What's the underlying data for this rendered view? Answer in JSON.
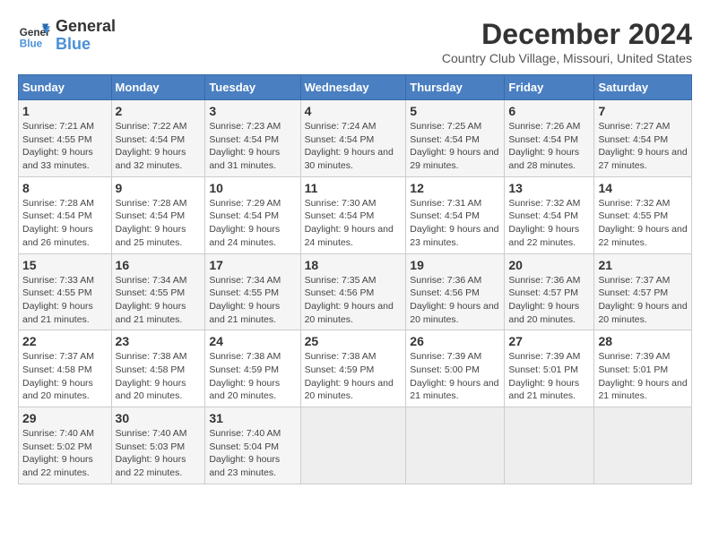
{
  "logo": {
    "line1": "General",
    "line2": "Blue"
  },
  "title": "December 2024",
  "subtitle": "Country Club Village, Missouri, United States",
  "days_header": [
    "Sunday",
    "Monday",
    "Tuesday",
    "Wednesday",
    "Thursday",
    "Friday",
    "Saturday"
  ],
  "weeks": [
    [
      {
        "day": "1",
        "sunrise": "7:21 AM",
        "sunset": "4:55 PM",
        "daylight": "9 hours and 33 minutes."
      },
      {
        "day": "2",
        "sunrise": "7:22 AM",
        "sunset": "4:54 PM",
        "daylight": "9 hours and 32 minutes."
      },
      {
        "day": "3",
        "sunrise": "7:23 AM",
        "sunset": "4:54 PM",
        "daylight": "9 hours and 31 minutes."
      },
      {
        "day": "4",
        "sunrise": "7:24 AM",
        "sunset": "4:54 PM",
        "daylight": "9 hours and 30 minutes."
      },
      {
        "day": "5",
        "sunrise": "7:25 AM",
        "sunset": "4:54 PM",
        "daylight": "9 hours and 29 minutes."
      },
      {
        "day": "6",
        "sunrise": "7:26 AM",
        "sunset": "4:54 PM",
        "daylight": "9 hours and 28 minutes."
      },
      {
        "day": "7",
        "sunrise": "7:27 AM",
        "sunset": "4:54 PM",
        "daylight": "9 hours and 27 minutes."
      }
    ],
    [
      {
        "day": "8",
        "sunrise": "7:28 AM",
        "sunset": "4:54 PM",
        "daylight": "9 hours and 26 minutes."
      },
      {
        "day": "9",
        "sunrise": "7:28 AM",
        "sunset": "4:54 PM",
        "daylight": "9 hours and 25 minutes."
      },
      {
        "day": "10",
        "sunrise": "7:29 AM",
        "sunset": "4:54 PM",
        "daylight": "9 hours and 24 minutes."
      },
      {
        "day": "11",
        "sunrise": "7:30 AM",
        "sunset": "4:54 PM",
        "daylight": "9 hours and 24 minutes."
      },
      {
        "day": "12",
        "sunrise": "7:31 AM",
        "sunset": "4:54 PM",
        "daylight": "9 hours and 23 minutes."
      },
      {
        "day": "13",
        "sunrise": "7:32 AM",
        "sunset": "4:54 PM",
        "daylight": "9 hours and 22 minutes."
      },
      {
        "day": "14",
        "sunrise": "7:32 AM",
        "sunset": "4:55 PM",
        "daylight": "9 hours and 22 minutes."
      }
    ],
    [
      {
        "day": "15",
        "sunrise": "7:33 AM",
        "sunset": "4:55 PM",
        "daylight": "9 hours and 21 minutes."
      },
      {
        "day": "16",
        "sunrise": "7:34 AM",
        "sunset": "4:55 PM",
        "daylight": "9 hours and 21 minutes."
      },
      {
        "day": "17",
        "sunrise": "7:34 AM",
        "sunset": "4:55 PM",
        "daylight": "9 hours and 21 minutes."
      },
      {
        "day": "18",
        "sunrise": "7:35 AM",
        "sunset": "4:56 PM",
        "daylight": "9 hours and 20 minutes."
      },
      {
        "day": "19",
        "sunrise": "7:36 AM",
        "sunset": "4:56 PM",
        "daylight": "9 hours and 20 minutes."
      },
      {
        "day": "20",
        "sunrise": "7:36 AM",
        "sunset": "4:57 PM",
        "daylight": "9 hours and 20 minutes."
      },
      {
        "day": "21",
        "sunrise": "7:37 AM",
        "sunset": "4:57 PM",
        "daylight": "9 hours and 20 minutes."
      }
    ],
    [
      {
        "day": "22",
        "sunrise": "7:37 AM",
        "sunset": "4:58 PM",
        "daylight": "9 hours and 20 minutes."
      },
      {
        "day": "23",
        "sunrise": "7:38 AM",
        "sunset": "4:58 PM",
        "daylight": "9 hours and 20 minutes."
      },
      {
        "day": "24",
        "sunrise": "7:38 AM",
        "sunset": "4:59 PM",
        "daylight": "9 hours and 20 minutes."
      },
      {
        "day": "25",
        "sunrise": "7:38 AM",
        "sunset": "4:59 PM",
        "daylight": "9 hours and 20 minutes."
      },
      {
        "day": "26",
        "sunrise": "7:39 AM",
        "sunset": "5:00 PM",
        "daylight": "9 hours and 21 minutes."
      },
      {
        "day": "27",
        "sunrise": "7:39 AM",
        "sunset": "5:01 PM",
        "daylight": "9 hours and 21 minutes."
      },
      {
        "day": "28",
        "sunrise": "7:39 AM",
        "sunset": "5:01 PM",
        "daylight": "9 hours and 21 minutes."
      }
    ],
    [
      {
        "day": "29",
        "sunrise": "7:40 AM",
        "sunset": "5:02 PM",
        "daylight": "9 hours and 22 minutes."
      },
      {
        "day": "30",
        "sunrise": "7:40 AM",
        "sunset": "5:03 PM",
        "daylight": "9 hours and 22 minutes."
      },
      {
        "day": "31",
        "sunrise": "7:40 AM",
        "sunset": "5:04 PM",
        "daylight": "9 hours and 23 minutes."
      },
      null,
      null,
      null,
      null
    ]
  ]
}
